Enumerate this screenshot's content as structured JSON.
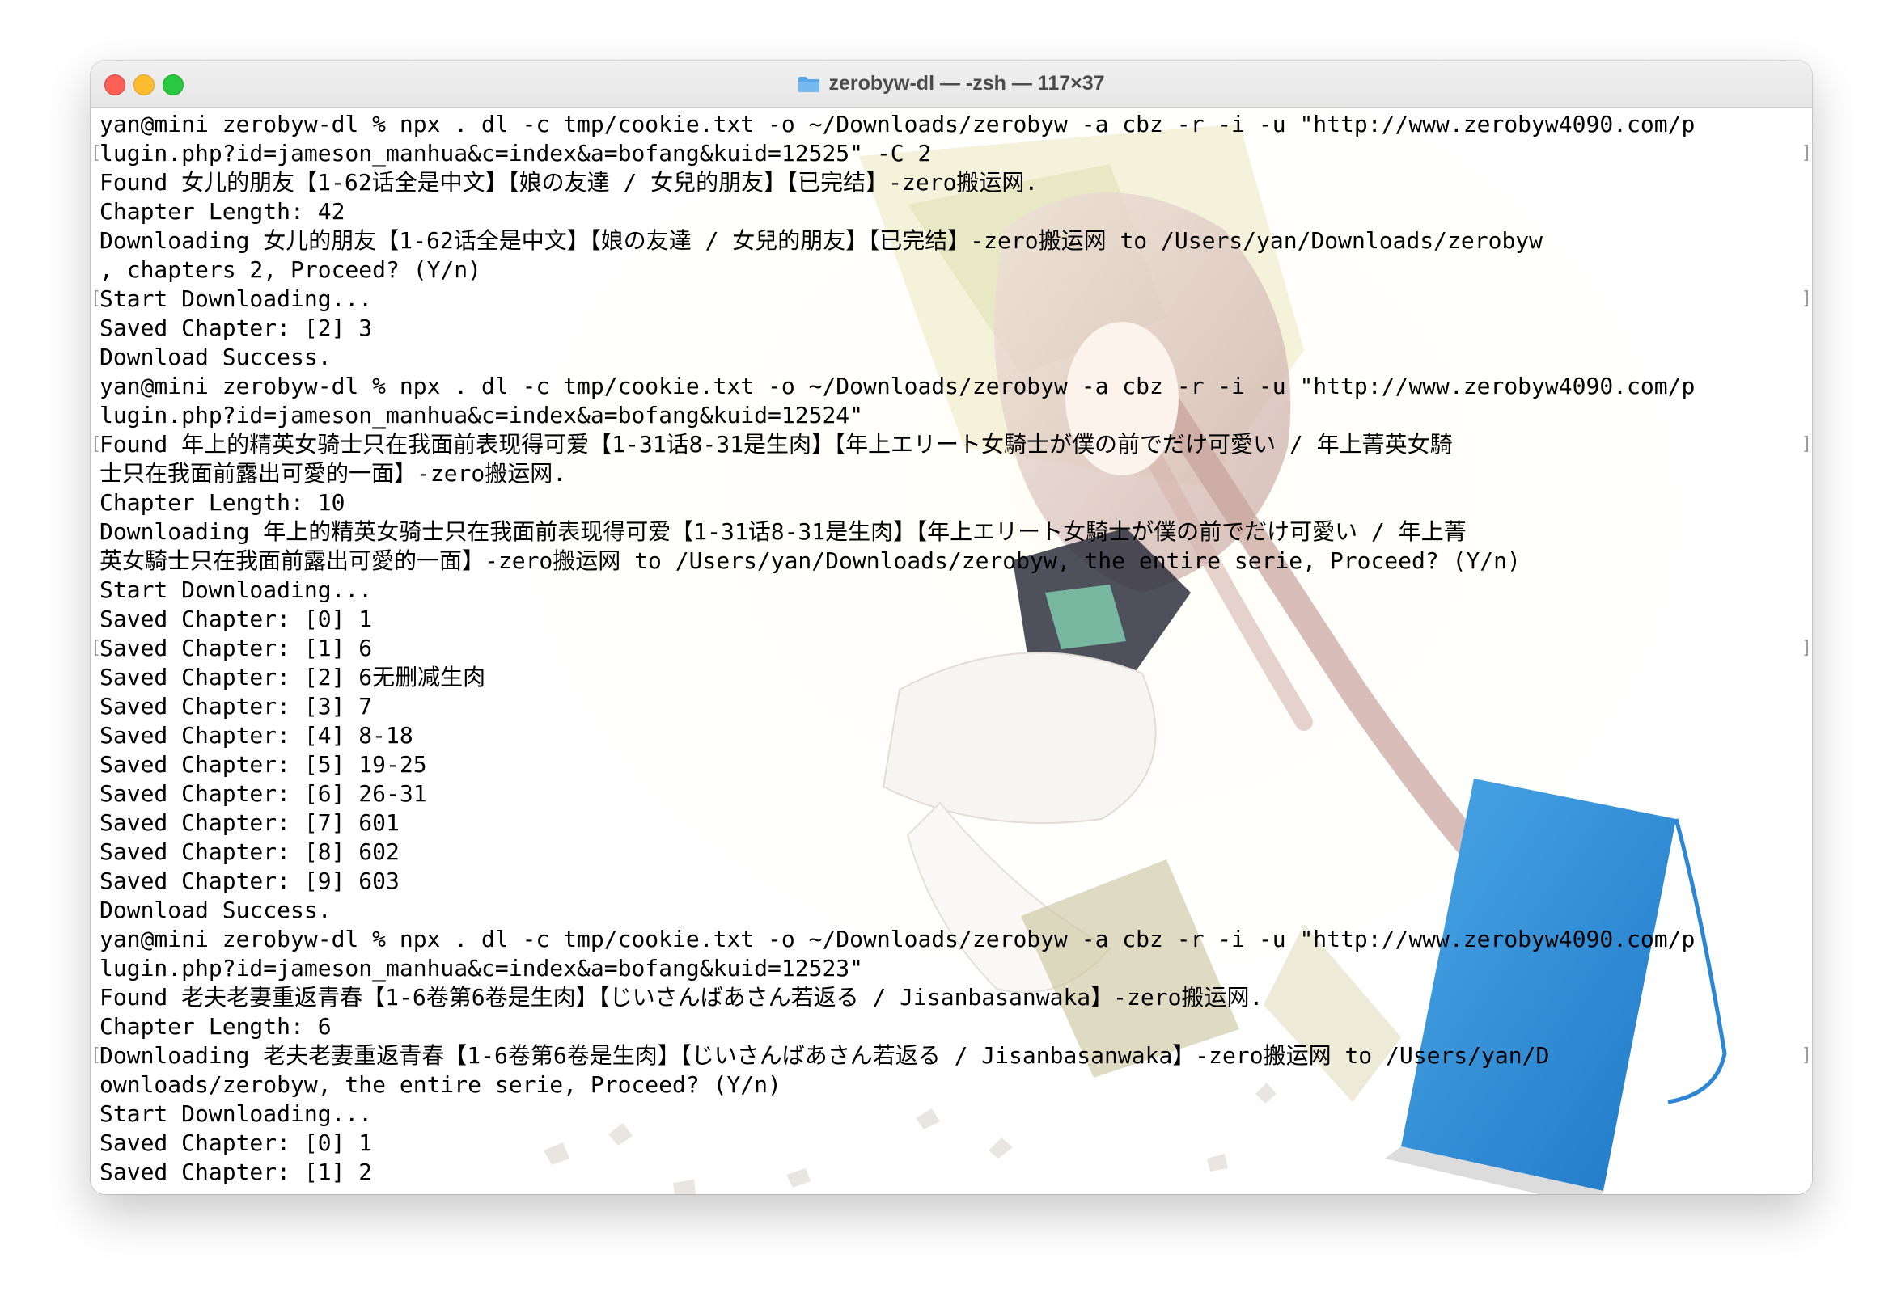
{
  "window": {
    "title": "zerobyw-dl — -zsh — 117×37",
    "title_icon": "folder-icon",
    "controls": [
      "close-button",
      "minimize-button",
      "zoom-button"
    ]
  },
  "colors": {
    "close": "#fe5f57",
    "minimize": "#febc2e",
    "zoom": "#28c840",
    "folder": "#5aa7e8",
    "book": "#2f8fd8"
  },
  "terminal": {
    "lines": [
      "yan@mini zerobyw-dl % npx . dl -c tmp/cookie.txt -o ~/Downloads/zerobyw -a cbz -r -i -u \"http://www.zerobyw4090.com/p",
      "lugin.php?id=jameson_manhua&c=index&a=bofang&kuid=12525\" -C 2",
      "Found 女儿的朋友【1-62话全是中文】【娘の友達 / 女兒的朋友】【已完结】-zero搬运网.",
      "Chapter Length: 42",
      "Downloading 女儿的朋友【1-62话全是中文】【娘の友達 / 女兒的朋友】【已完结】-zero搬运网 to /Users/yan/Downloads/zerobyw",
      ", chapters 2, Proceed? (Y/n)",
      "Start Downloading...",
      "Saved Chapter: [2] 3",
      "Download Success.",
      "yan@mini zerobyw-dl % npx . dl -c tmp/cookie.txt -o ~/Downloads/zerobyw -a cbz -r -i -u \"http://www.zerobyw4090.com/p",
      "lugin.php?id=jameson_manhua&c=index&a=bofang&kuid=12524\"",
      "Found 年上的精英女骑士只在我面前表现得可爱【1-31话8-31是生肉】【年上エリート女騎士が僕の前でだけ可愛い / 年上菁英女騎",
      "士只在我面前露出可愛的一面】-zero搬运网.",
      "Chapter Length: 10",
      "Downloading 年上的精英女骑士只在我面前表现得可爱【1-31话8-31是生肉】【年上エリート女騎士が僕の前でだけ可愛い / 年上菁",
      "英女騎士只在我面前露出可愛的一面】-zero搬运网 to /Users/yan/Downloads/zerobyw, the entire serie, Proceed? (Y/n)",
      "Start Downloading...",
      "Saved Chapter: [0] 1",
      "Saved Chapter: [1] 6",
      "Saved Chapter: [2] 6无删减生肉",
      "Saved Chapter: [3] 7",
      "Saved Chapter: [4] 8-18",
      "Saved Chapter: [5] 19-25",
      "Saved Chapter: [6] 26-31",
      "Saved Chapter: [7] 601",
      "Saved Chapter: [8] 602",
      "Saved Chapter: [9] 603",
      "Download Success.",
      "yan@mini zerobyw-dl % npx . dl -c tmp/cookie.txt -o ~/Downloads/zerobyw -a cbz -r -i -u \"http://www.zerobyw4090.com/p",
      "lugin.php?id=jameson_manhua&c=index&a=bofang&kuid=12523\"",
      "Found 老夫老妻重返青春【1-6卷第6卷是生肉】【じいさんばあさん若返る / Jisanbasanwaka】-zero搬运网.",
      "Chapter Length: 6",
      "Downloading 老夫老妻重返青春【1-6卷第6卷是生肉】【じいさんばあさん若返る / Jisanbasanwaka】-zero搬运网 to /Users/yan/D",
      "ownloads/zerobyw, the entire serie, Proceed? (Y/n)",
      "Start Downloading...",
      "Saved Chapter: [0] 1",
      "Saved Chapter: [1] 2"
    ]
  }
}
